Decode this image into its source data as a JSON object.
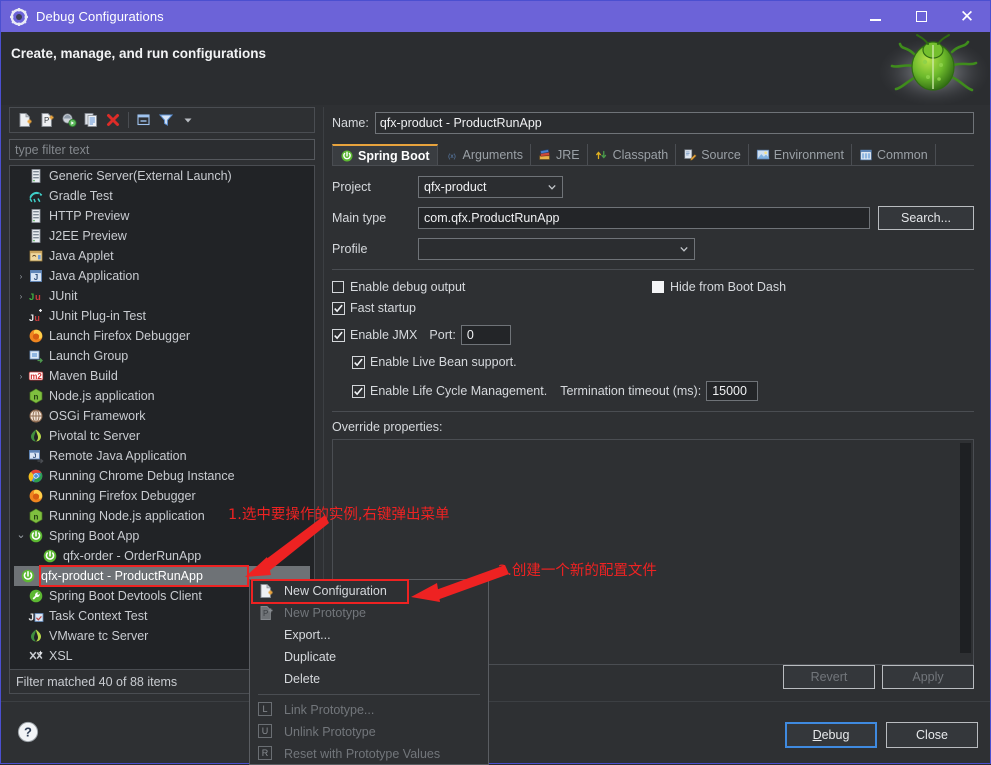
{
  "window": {
    "title": "Debug Configurations",
    "icon": "gear-icon",
    "minimize": "–",
    "maximize": "□",
    "close": "✕"
  },
  "banner": {
    "title": "Create, manage, and run configurations",
    "art_icon": "green-bug-icon"
  },
  "toolbar": {
    "buttons": [
      {
        "name": "new-configuration-icon",
        "tip": "New Configuration"
      },
      {
        "name": "new-prototype-icon",
        "tip": "New Prototype"
      },
      {
        "name": "export-icon",
        "tip": "Export"
      },
      {
        "name": "duplicate-icon",
        "tip": "Duplicate"
      },
      {
        "name": "delete-icon",
        "tip": "Delete"
      },
      {
        "name": "collapse-all-icon",
        "tip": "Collapse All"
      },
      {
        "name": "filter-icon",
        "tip": "Filter"
      },
      {
        "name": "chevron-down-icon",
        "tip": "Menu"
      }
    ]
  },
  "filter": {
    "placeholder": "type filter text",
    "value": ""
  },
  "tree": {
    "items": [
      {
        "label": "Generic Server(External Launch)",
        "icon": "server-icon",
        "indent": 1,
        "arrow": "",
        "selected": false
      },
      {
        "label": "Gradle Test",
        "icon": "gradle-icon",
        "indent": 1,
        "arrow": "",
        "selected": false
      },
      {
        "label": "HTTP Preview",
        "icon": "server-icon",
        "indent": 1,
        "arrow": "",
        "selected": false
      },
      {
        "label": "J2EE Preview",
        "icon": "server-icon",
        "indent": 1,
        "arrow": "",
        "selected": false
      },
      {
        "label": "Java Applet",
        "icon": "applet-icon",
        "indent": 1,
        "arrow": "",
        "selected": false
      },
      {
        "label": "Java Application",
        "icon": "java-icon",
        "indent": 1,
        "arrow": "›",
        "selected": false
      },
      {
        "label": "JUnit",
        "icon": "junit-icon",
        "indent": 1,
        "arrow": "›",
        "selected": false
      },
      {
        "label": "JUnit Plug-in Test",
        "icon": "junit-plugin-icon",
        "indent": 1,
        "arrow": "",
        "selected": false
      },
      {
        "label": "Launch Firefox Debugger",
        "icon": "firefox-icon",
        "indent": 1,
        "arrow": "",
        "selected": false
      },
      {
        "label": "Launch Group",
        "icon": "launch-group-icon",
        "indent": 1,
        "arrow": "",
        "selected": false
      },
      {
        "label": "Maven Build",
        "icon": "maven-icon",
        "indent": 1,
        "arrow": "›",
        "selected": false
      },
      {
        "label": "Node.js application",
        "icon": "nodejs-icon",
        "indent": 1,
        "arrow": "",
        "selected": false
      },
      {
        "label": "OSGi Framework",
        "icon": "osgi-icon",
        "indent": 1,
        "arrow": "",
        "selected": false
      },
      {
        "label": "Pivotal tc Server",
        "icon": "pivotal-icon",
        "indent": 1,
        "arrow": "",
        "selected": false
      },
      {
        "label": "Remote Java Application",
        "icon": "remote-java-icon",
        "indent": 1,
        "arrow": "",
        "selected": false
      },
      {
        "label": "Running Chrome Debug Instance",
        "icon": "chrome-icon",
        "indent": 1,
        "arrow": "",
        "selected": false
      },
      {
        "label": "Running Firefox Debugger",
        "icon": "firefox-icon",
        "indent": 1,
        "arrow": "",
        "selected": false
      },
      {
        "label": "Running Node.js application",
        "icon": "nodejs-icon",
        "indent": 1,
        "arrow": "",
        "selected": false
      },
      {
        "label": "Spring Boot App",
        "icon": "spring-boot-icon",
        "indent": 1,
        "arrow": "⌄",
        "selected": false
      },
      {
        "label": "qfx-order - OrderRunApp",
        "icon": "spring-boot-icon",
        "indent": 2,
        "arrow": "",
        "selected": false
      },
      {
        "label": "qfx-product - ProductRunApp",
        "icon": "spring-boot-icon",
        "indent": 2,
        "arrow": "",
        "selected": true
      },
      {
        "label": "Spring Boot Devtools Client",
        "icon": "devtools-icon",
        "indent": 1,
        "arrow": "",
        "selected": false
      },
      {
        "label": "Task Context Test",
        "icon": "task-context-icon",
        "indent": 1,
        "arrow": "",
        "selected": false
      },
      {
        "label": "VMware tc Server",
        "icon": "pivotal-icon",
        "indent": 1,
        "arrow": "",
        "selected": false
      },
      {
        "label": "XSL",
        "icon": "xsl-icon",
        "indent": 1,
        "arrow": "",
        "selected": false
      }
    ],
    "status": "Filter matched 40 of 88 items"
  },
  "help": {
    "icon": "help-icon"
  },
  "details": {
    "name_label": "Name:",
    "name_value": "qfx-product - ProductRunApp",
    "tabs": [
      {
        "label": "Spring Boot",
        "icon": "spring-boot-icon",
        "active": true
      },
      {
        "label": "Arguments",
        "icon": "arguments-icon",
        "active": false
      },
      {
        "label": "JRE",
        "icon": "jre-icon",
        "active": false
      },
      {
        "label": "Classpath",
        "icon": "classpath-icon",
        "active": false
      },
      {
        "label": "Source",
        "icon": "source-icon",
        "active": false
      },
      {
        "label": "Environment",
        "icon": "environment-icon",
        "active": false
      },
      {
        "label": "Common",
        "icon": "common-icon",
        "active": false
      }
    ],
    "project_label": "Project",
    "project_value": "qfx-product",
    "main_type_label": "Main type",
    "main_type_value": "com.qfx.ProductRunApp",
    "search_button": "Search...",
    "profile_label": "Profile",
    "profile_value": "",
    "checkboxes": {
      "enable_debug_output": {
        "label": "Enable debug output",
        "checked": false
      },
      "hide_from_boot_dash": {
        "label": "Hide from Boot Dash",
        "checked": false
      },
      "fast_startup": {
        "label": "Fast startup",
        "checked": true
      },
      "enable_jmx": {
        "label": "Enable JMX",
        "checked": true
      },
      "enable_live_bean": {
        "label": "Enable Live Bean support.",
        "checked": true
      },
      "enable_life_cycle": {
        "label": "Enable Life Cycle Management.",
        "checked": true
      }
    },
    "port_label": "Port:",
    "port_value": "0",
    "termination_label": "Termination timeout (ms):",
    "termination_value": "15000",
    "override_label": "Override properties:",
    "revert_button": "Revert",
    "apply_button": "Apply"
  },
  "footer": {
    "debug_button_prefix": "",
    "debug_button_key": "D",
    "debug_button_rest": "ebug",
    "close_button": "Close"
  },
  "context_menu": {
    "items": [
      {
        "label": "New Configuration",
        "icon": "new-configuration-icon",
        "enabled": true,
        "separator_after": false
      },
      {
        "label": "New Prototype",
        "icon": "new-prototype-icon",
        "enabled": false,
        "separator_after": false
      },
      {
        "label": "Export...",
        "icon": "export-icon",
        "enabled": true,
        "separator_after": false
      },
      {
        "label": "Duplicate",
        "icon": "duplicate-icon",
        "enabled": true,
        "separator_after": false
      },
      {
        "label": "Delete",
        "icon": "delete-icon",
        "enabled": true,
        "separator_after": true
      },
      {
        "label": "Link Prototype...",
        "icon": "link-prototype-icon",
        "key": "L",
        "enabled": false,
        "separator_after": false
      },
      {
        "label": "Unlink Prototype",
        "icon": "unlink-prototype-icon",
        "key": "U",
        "enabled": false,
        "separator_after": false
      },
      {
        "label": "Reset with Prototype Values",
        "icon": "reset-prototype-icon",
        "key": "R",
        "enabled": false,
        "separator_after": false
      }
    ]
  },
  "annotations": [
    {
      "text": "1.选中要操作的实例,右键弹出菜单",
      "color": "#ee2222"
    },
    {
      "text": "2.创建一个新的配置文件",
      "color": "#ee2222"
    }
  ],
  "colors": {
    "titlebar": "#6c63d8",
    "background": "#2e3033",
    "tree_bg": "#212326",
    "accent_tab": "#e8a33d",
    "focus_border": "#3f8ae0",
    "annotation": "#ee2222"
  }
}
